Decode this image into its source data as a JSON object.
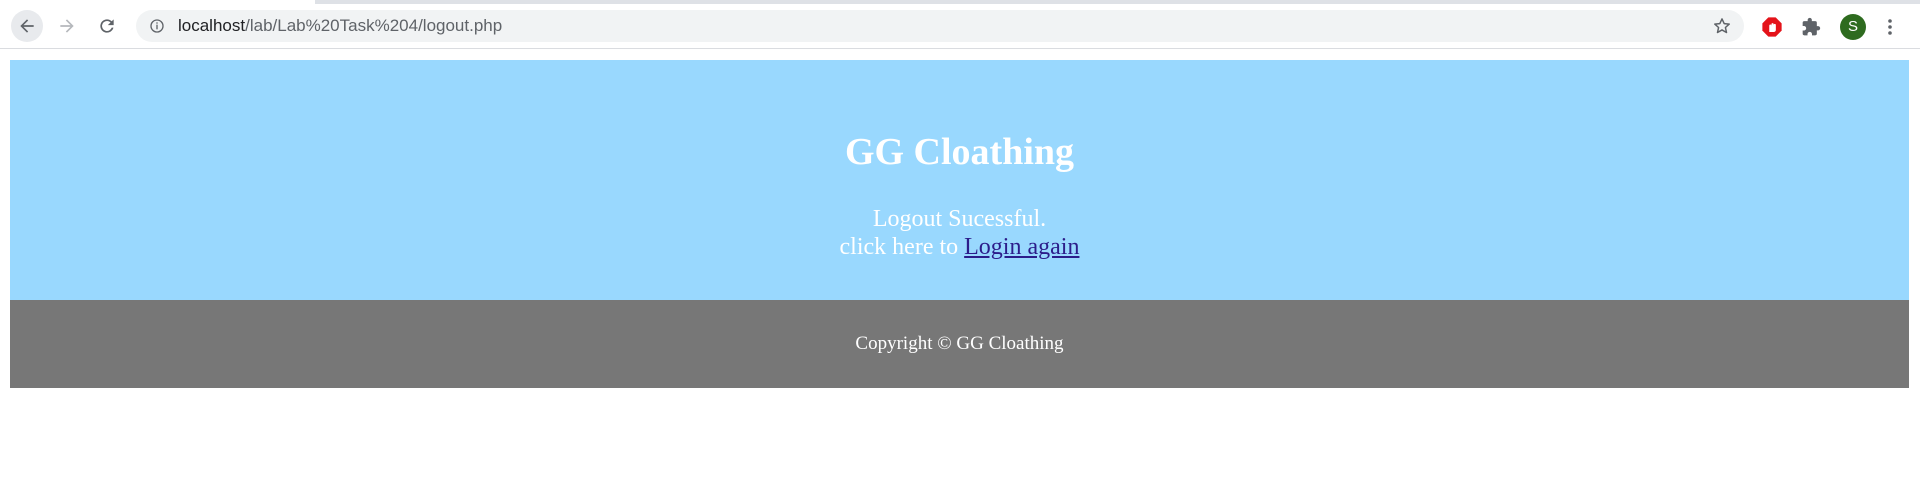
{
  "browser": {
    "url_host": "localhost",
    "url_path": "/lab/Lab%20Task%204/logout.php",
    "avatar_letter": "S",
    "icons": {
      "back": "arrow-left-icon",
      "forward": "arrow-right-icon",
      "reload": "reload-icon",
      "info": "info-icon",
      "bookmark": "star-icon",
      "adblock": "adblock-icon",
      "extensions": "puzzle-icon",
      "menu": "kebab-menu-icon"
    },
    "colors": {
      "avatar": "#2e6b1f",
      "adblock": "#e4131a"
    }
  },
  "page": {
    "title": "GG Cloathing",
    "message": "Logout Sucessful.",
    "prompt_text": "click here to ",
    "link_label": "Login again",
    "footer_text": "Copyright © GG Cloathing",
    "colors": {
      "hero_background": "#99d8fe",
      "footer_background": "#777777",
      "text": "#ffffff",
      "link": "#2c1d8a"
    }
  }
}
